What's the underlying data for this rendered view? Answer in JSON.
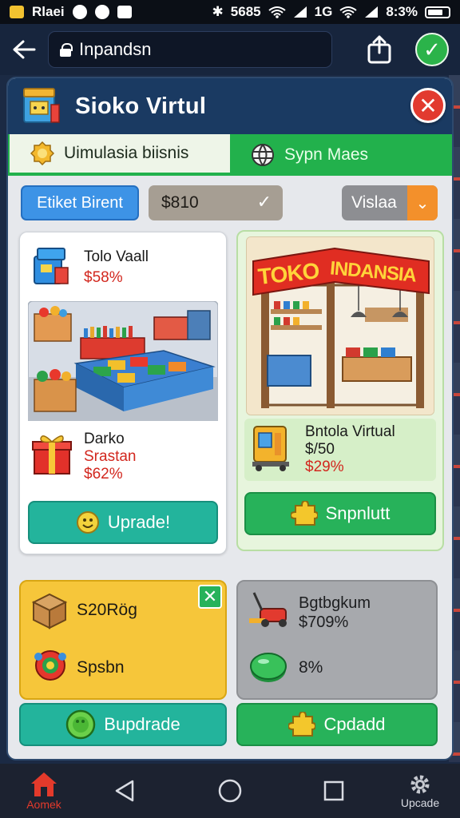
{
  "status_bar": {
    "left_text": "Rlaei",
    "center_text": "5685",
    "right_text": "8:3%"
  },
  "browser": {
    "url": "Inpandsn"
  },
  "dialog": {
    "title": "Sioko Virtul",
    "tabs": [
      {
        "label": "Uimulasia biisnis",
        "active": true
      },
      {
        "label": "Sypn Maes",
        "active": false
      }
    ]
  },
  "filters": {
    "button_label": "Etiket Birent",
    "price_value": "$810",
    "region_value": "Vislaa"
  },
  "left_card": {
    "item1_name": "Tolo Vaall",
    "item1_price": "$58%",
    "item2_name": "Darko",
    "item2_sub": "Srastan",
    "item2_price": "$62%",
    "button_label": "Uprade!"
  },
  "right_card": {
    "sign_word1": "TOKO",
    "sign_word2": "INDANSIA",
    "item_name": "Bntola Virtual",
    "item_price": "$/50",
    "item_pct": "$29%",
    "button_label": "Snpnlutt"
  },
  "yellow_card": {
    "row1_text": "S20Rög",
    "row2_text": "Spsbn",
    "button_label": "Bupdrade"
  },
  "gray_card": {
    "row1_name": "Bgtbgkum",
    "row1_price": "$709%",
    "row2_text": "8%",
    "button_label": "Cpdadd"
  },
  "navbar": {
    "home_label": "Aomek",
    "upgrade_label": "Upcade"
  },
  "colors": {
    "header": "#1a3a62",
    "green": "#27b25a",
    "teal": "#23b49c",
    "red_price": "#d2271e",
    "yellow": "#f6c63a"
  }
}
